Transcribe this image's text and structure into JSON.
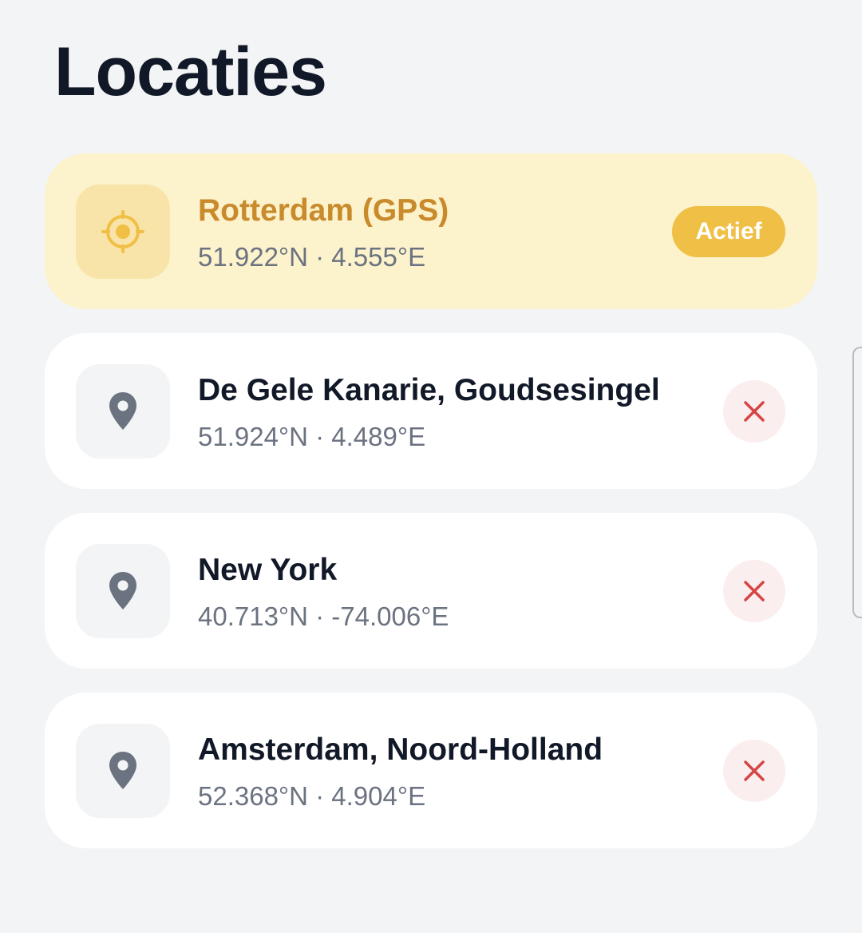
{
  "page": {
    "title": "Locaties"
  },
  "colors": {
    "background": "#f3f4f6",
    "active_card": "#fcf2cb",
    "active_text": "#c98a2c",
    "badge": "#f0bf45",
    "delete_icon": "#d64545",
    "pin_icon": "#6b7280"
  },
  "locations": [
    {
      "name": "Rotterdam (GPS)",
      "coords": "51.922°N · 4.555°E",
      "icon": "gps-target-icon",
      "active": true,
      "badge": "Actief"
    },
    {
      "name": "De Gele Kanarie, Goudsesingel",
      "coords": "51.924°N · 4.489°E",
      "icon": "map-pin-icon",
      "active": false
    },
    {
      "name": "New York",
      "coords": "40.713°N · -74.006°E",
      "icon": "map-pin-icon",
      "active": false
    },
    {
      "name": "Amsterdam, Noord-Holland",
      "coords": "52.368°N · 4.904°E",
      "icon": "map-pin-icon",
      "active": false
    }
  ]
}
